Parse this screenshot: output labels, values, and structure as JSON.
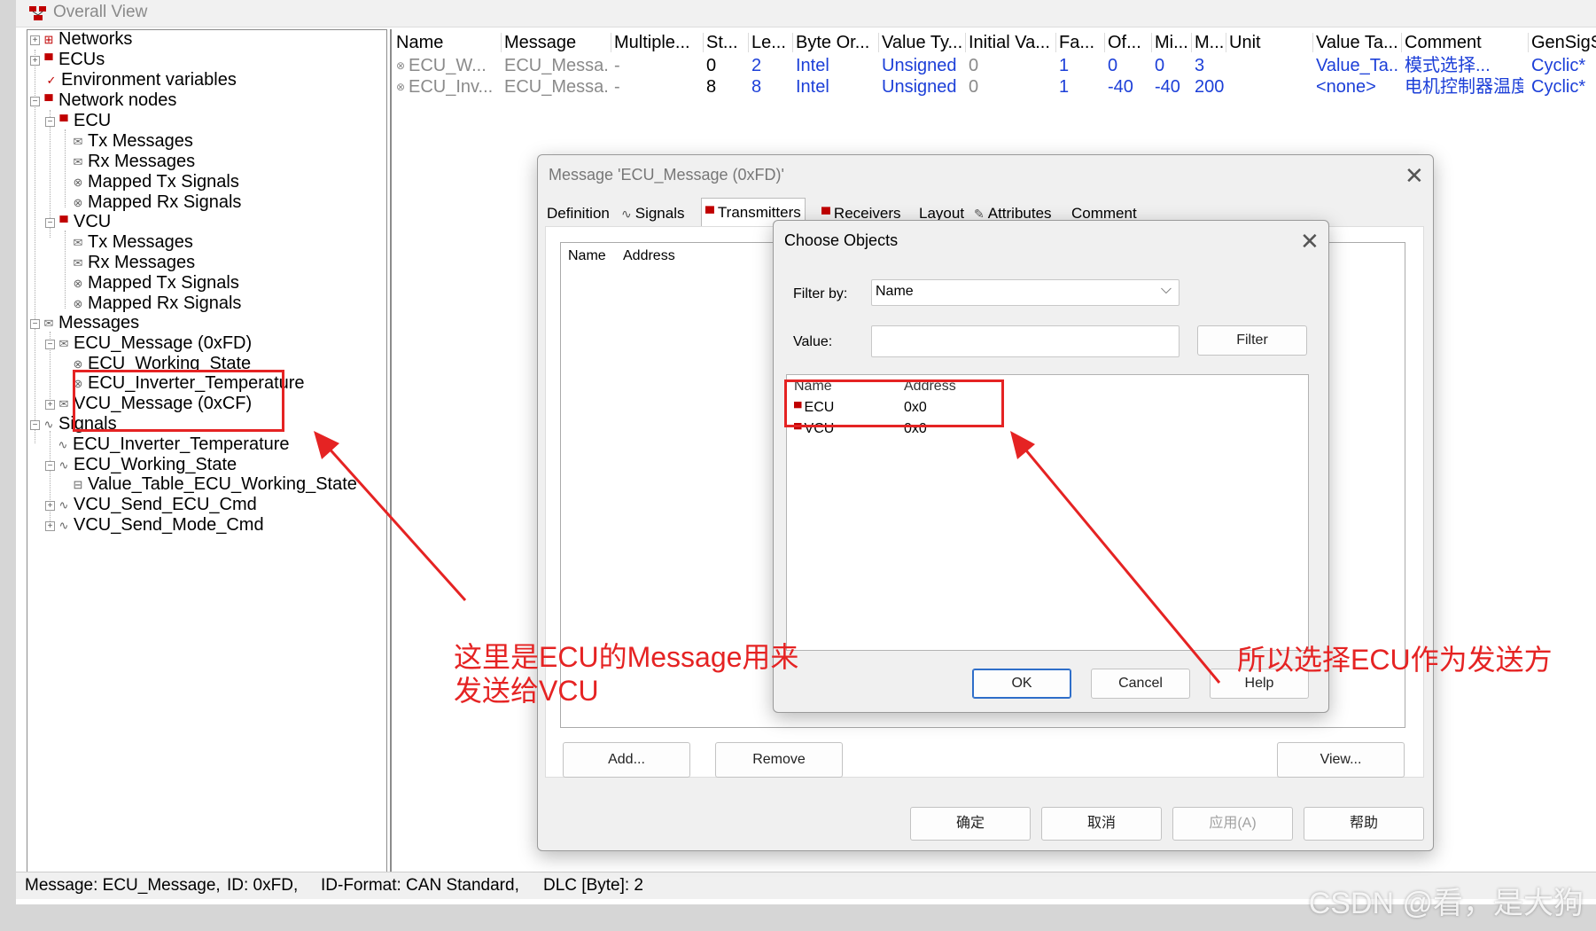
{
  "window": {
    "title": "Overall View"
  },
  "tree": {
    "networks": "Networks",
    "ecus": "ECUs",
    "env": "Environment variables",
    "network_nodes": "Network nodes",
    "ecu": "ECU",
    "vcu": "VCU",
    "tx_messages": "Tx Messages",
    "rx_messages": "Rx Messages",
    "mapped_tx": "Mapped Tx Signals",
    "mapped_rx": "Mapped Rx Signals",
    "messages": "Messages",
    "ecu_message": "ECU_Message (0xFD)",
    "ecu_working_state": "ECU_Working_State",
    "ecu_inverter_temp": "ECU_Inverter_Temperature",
    "vcu_message": "VCU_Message (0xCF)",
    "signals": "Signals",
    "sig_inverter_temp": "ECU_Inverter_Temperature",
    "sig_working_state": "ECU_Working_State",
    "value_table": "Value_Table_ECU_Working_State",
    "vcu_send_ecu_cmd": "VCU_Send_ECU_Cmd",
    "vcu_send_mode_cmd": "VCU_Send_Mode_Cmd"
  },
  "grid": {
    "headers": [
      "Name",
      "Message",
      "Multiple...",
      "St...",
      "Le...",
      "Byte Or...",
      "Value Ty...",
      "Initial Va...",
      "Fa...",
      "Of...",
      "Mi...",
      "M...",
      "Unit",
      "Value Ta...",
      "Comment",
      "GenSigS"
    ],
    "rows": [
      [
        "ECU_W...",
        "ECU_Messa...",
        "-",
        "0",
        "2",
        "Intel",
        "Unsigned",
        "0",
        "1",
        "0",
        "0",
        "3",
        "",
        "Value_Ta...",
        "模式选择...",
        "Cyclic*"
      ],
      [
        "ECU_Inv...",
        "ECU_Messa...",
        "-",
        "8",
        "8",
        "Intel",
        "Unsigned",
        "0",
        "1",
        "-40",
        "-40",
        "200",
        "",
        "<none>",
        "电机控制器温度...",
        "Cyclic*"
      ]
    ]
  },
  "status": {
    "message": "Message: ECU_Message,",
    "id": "ID: 0xFD,",
    "format": "ID-Format: CAN Standard,",
    "dlc": "DLC [Byte]: 2"
  },
  "message_dialog": {
    "title": "Message 'ECU_Message (0xFD)'",
    "tabs": [
      "Definition",
      "Signals",
      "Transmitters",
      "Receivers",
      "Layout",
      "Attributes",
      "Comment"
    ],
    "list_headers": [
      "Name",
      "Address"
    ],
    "add": "Add...",
    "remove": "Remove",
    "view": "View...",
    "ok": "确定",
    "cancel": "取消",
    "apply": "应用(A)",
    "help": "帮助"
  },
  "choose_dialog": {
    "title": "Choose Objects",
    "filter_by_label": "Filter by:",
    "filter_by_value": "Name",
    "value_label": "Value:",
    "value_text": "",
    "filter_button": "Filter",
    "list_headers": [
      "Name",
      "Address"
    ],
    "rows": [
      {
        "name": "ECU",
        "address": "0x0"
      },
      {
        "name": "VCU",
        "address": "0x0"
      }
    ],
    "ok": "OK",
    "cancel": "Cancel",
    "help": "Help"
  },
  "annotations": {
    "left_note_line1": "这里是ECU的Message用来",
    "left_note_line2": "发送给VCU",
    "right_note": "所以选择ECU作为发送方",
    "color": "#e52323"
  },
  "watermark": "CSDN @看，是大狗"
}
